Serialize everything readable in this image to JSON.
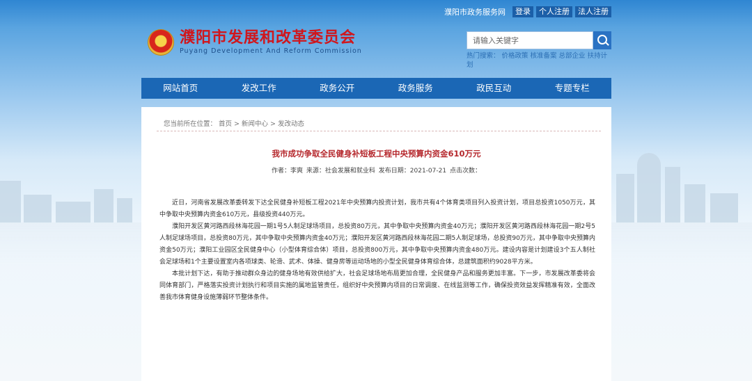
{
  "header": {
    "site_link": "濮阳市政务服务网",
    "login": "登录",
    "personal_register": "个人注册",
    "corporate_register": "法人注册",
    "logo_cn": "濮阳市发展和改革委员会",
    "logo_en": "Puyang Development And Reform Commission",
    "search_placeholder": "请输入关键字",
    "hot_label": "热门搜索：",
    "hot_terms": [
      "价格政策",
      "核准备案",
      "总部企业",
      "扶持计划"
    ]
  },
  "nav": [
    "网站首页",
    "发改工作",
    "政务公开",
    "政务服务",
    "政民互动",
    "专题专栏"
  ],
  "breadcrumb": {
    "prefix": "您当前所在位置：",
    "items": [
      "首页",
      ">",
      "新闻中心",
      ">",
      "发改动态"
    ]
  },
  "article": {
    "title": "我市成功争取全民健身补短板工程中央预算内资金610万元",
    "author": "作者：李爽",
    "source": "来源：社会发展和就业科",
    "date": "发布日期：2021-07-21",
    "views": "点击次数：",
    "paragraphs": [
      "近日，河南省发展改革委转发下达全民健身补短板工程2021年中央预算内投资计划，我市共有4个体育类项目列入投资计划，项目总投资1050万元，其中争取中央预算内资金610万元，县级投资440万元。",
      "濮阳开发区黄河路西段林海花园一期1号5人制足球场项目，总投资80万元，其中争取中央预算内资金40万元；濮阳开发区黄河路西段林海花园一期2号5人制足球场项目，总投资80万元，其中争取中央预算内资金40万元；濮阳开发区黄河路西段林海花园二期5人制足球场，总投资90万元，其中争取中央预算内资金50万元；濮阳工业园区全民健身中心（小型体育综合体）项目，总投资800万元，其中争取中央预算内资金480万元。建设内容是计划建设3个五人制社会足球场和1个主要设置室内各项球类、轮滑、武术、体操、健身房等运动场地的小型全民健身体育综合体，总建筑面积约9028平方米。",
      "本批计划下达，有助于推动群众身边的健身场地有效供给扩大，社会足球场地布局更加合理，全民健身产品和服务更加丰富。下一步，市发展改革委将会同体育部门，严格落实投资计划执行和项目实施的属地监管责任，组织好中央预算内项目的日常调度、在线监测等工作，确保投资效益发挥精准有效，全面改善我市体育健身设施薄弱环节整体条件。"
    ]
  },
  "colors": {
    "nav_bg": "#1b67b5",
    "title_red": "#b5272c",
    "logo_red": "#d0171d",
    "accent_blue": "#2a72c3"
  }
}
